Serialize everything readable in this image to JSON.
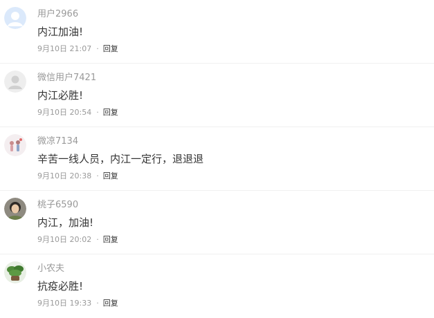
{
  "comments": [
    {
      "avatar": "default-blue-avatar-icon",
      "username": "用户2966",
      "content": "内江加油!",
      "time": "9月10日 21:07",
      "separator": "·",
      "reply_label": "回复"
    },
    {
      "avatar": "default-gray-avatar-icon",
      "username": "微信用户7421",
      "content": "内江必胜!",
      "time": "9月10日 20:54",
      "separator": "·",
      "reply_label": "回复"
    },
    {
      "avatar": "photo-avatar-figures",
      "username": "微凉7134",
      "content": "辛苦一线人员，内江一定行，退退退",
      "time": "9月10日 20:38",
      "separator": "·",
      "reply_label": "回复"
    },
    {
      "avatar": "photo-avatar-person",
      "username": "桃子6590",
      "content": "内江，加油!",
      "time": "9月10日 20:02",
      "separator": "·",
      "reply_label": "回复"
    },
    {
      "avatar": "photo-avatar-plant",
      "username": "小农夫",
      "content": "抗疫必胜!",
      "time": "9月10日 19:33",
      "separator": "·",
      "reply_label": "回复"
    }
  ],
  "colors": {
    "username": "#999999",
    "content": "#333333",
    "time": "#999999",
    "reply": "#333333",
    "divider": "#f0f0f0"
  }
}
